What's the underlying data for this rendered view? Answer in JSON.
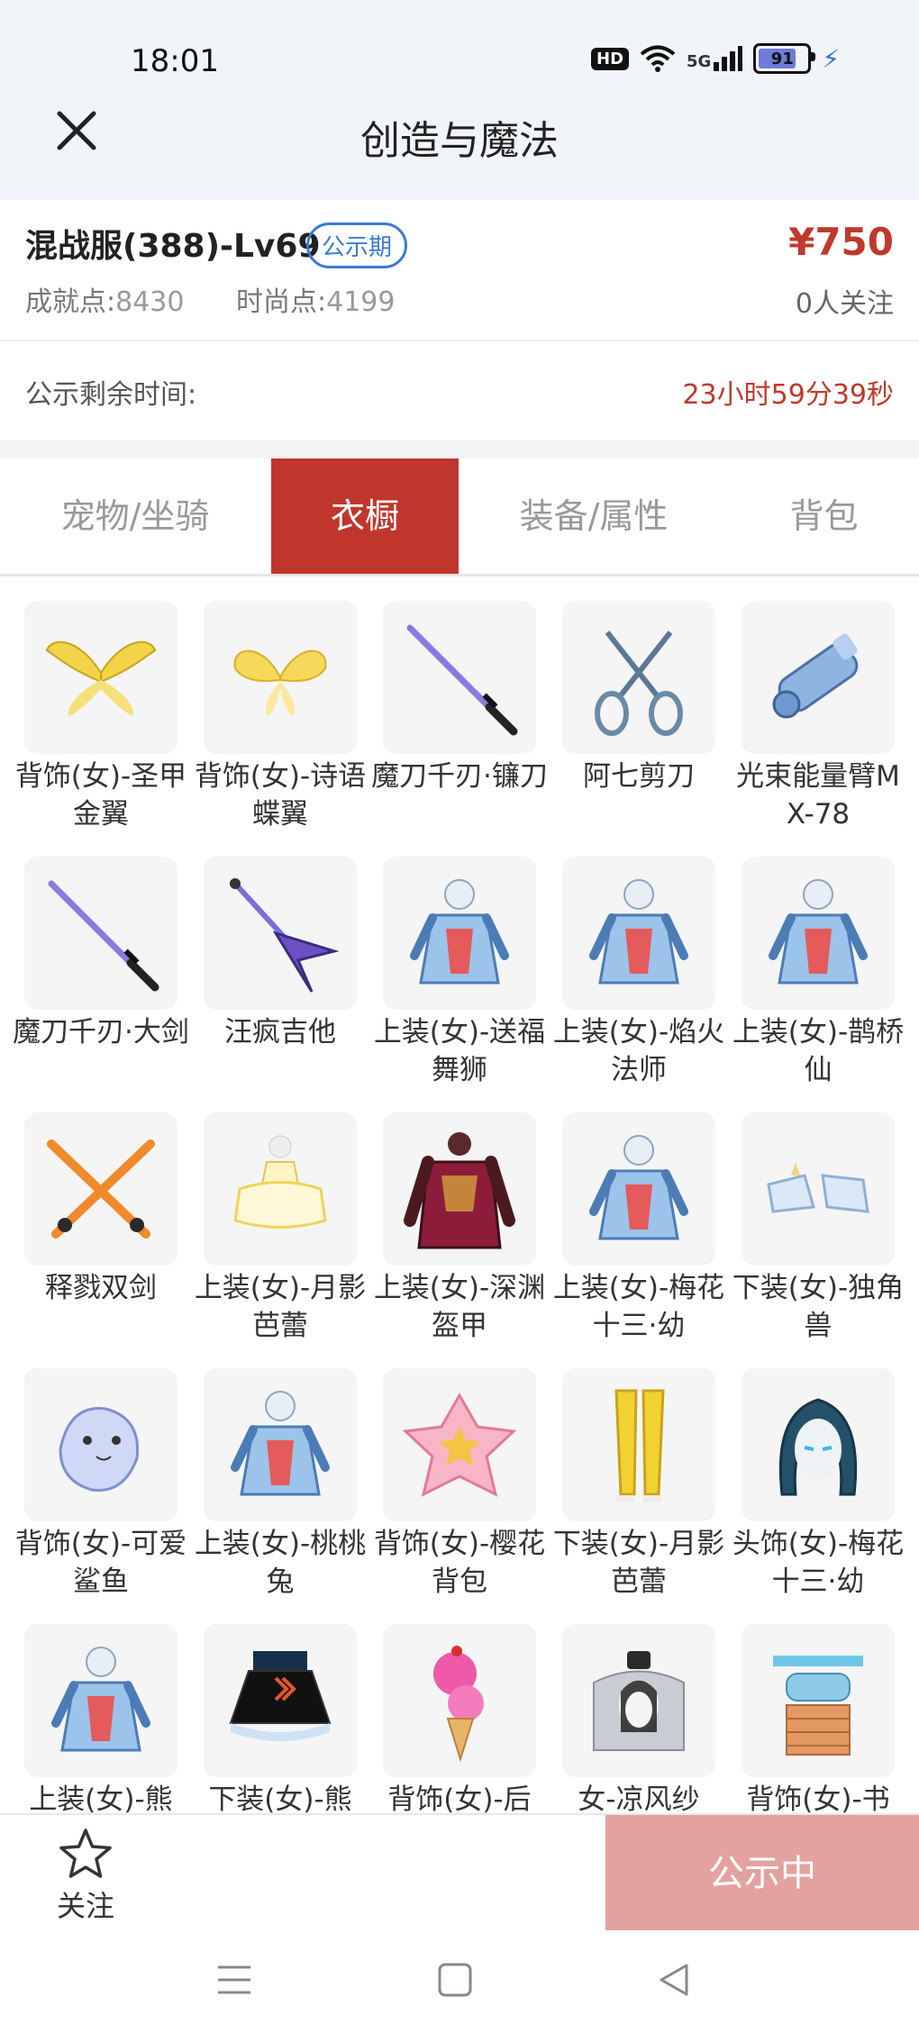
{
  "status_bar": {
    "time": "18:01",
    "hd": "HD",
    "network": "5G",
    "battery": "91"
  },
  "header": {
    "title": "创造与魔法"
  },
  "account": {
    "server": "混战服(388)-Lv69",
    "badge": "公示期",
    "achievement_label": "成就点:",
    "achievement_value": "8430",
    "fashion_label": "时尚点:",
    "fashion_value": "4199",
    "price": "¥750",
    "followers": "0人关注"
  },
  "remaining": {
    "label": "公示剩余时间:",
    "value": "23小时59分39秒"
  },
  "tabs": [
    {
      "label": "宠物/坐骑",
      "active": false
    },
    {
      "label": "衣橱",
      "active": true
    },
    {
      "label": "装备/属性",
      "active": false
    },
    {
      "label": "背包",
      "active": false
    }
  ],
  "items": [
    {
      "label": "背饰(女)-圣甲金翼",
      "icon": "wings-icon"
    },
    {
      "label": "背饰(女)-诗语蝶翼",
      "icon": "butterfly-wings-icon"
    },
    {
      "label": "魔刀千刃·镰刀",
      "icon": "blade-icon"
    },
    {
      "label": "阿七剪刀",
      "icon": "scissors-icon"
    },
    {
      "label": "光束能量臂MX-78",
      "icon": "arm-cannon-icon"
    },
    {
      "label": "魔刀千刃·大剑",
      "icon": "blade-icon"
    },
    {
      "label": "汪疯吉他",
      "icon": "guitar-icon"
    },
    {
      "label": "上装(女)-送福舞狮",
      "icon": "outfit-icon"
    },
    {
      "label": "上装(女)-焰火法师",
      "icon": "outfit-icon"
    },
    {
      "label": "上装(女)-鹊桥仙",
      "icon": "outfit-icon"
    },
    {
      "label": "释戮双剑",
      "icon": "twin-swords-icon"
    },
    {
      "label": "上装(女)-月影芭蕾",
      "icon": "dress-icon"
    },
    {
      "label": "上装(女)-深渊盔甲",
      "icon": "armor-icon"
    },
    {
      "label": "上装(女)-梅花十三·幼",
      "icon": "outfit-icon"
    },
    {
      "label": "下装(女)-独角兽",
      "icon": "shoes-icon"
    },
    {
      "label": "背饰(女)-可爱鲨鱼",
      "icon": "shark-icon"
    },
    {
      "label": "上装(女)-桃桃兔",
      "icon": "outfit-icon"
    },
    {
      "label": "背饰(女)-樱花背包",
      "icon": "backpack-icon"
    },
    {
      "label": "下装(女)-月影芭蕾",
      "icon": "pants-icon"
    },
    {
      "label": "头饰(女)-梅花十三·幼",
      "icon": "hair-icon"
    },
    {
      "label": "上装(女)-熊",
      "icon": "outfit-icon"
    },
    {
      "label": "下装(女)-熊",
      "icon": "skirt-icon"
    },
    {
      "label": "背饰(女)-后",
      "icon": "icecream-icon"
    },
    {
      "label": "女-凉风纱",
      "icon": "hat-icon"
    },
    {
      "label": "背饰(女)-书",
      "icon": "stall-icon"
    }
  ],
  "bottom": {
    "follow_label": "关注",
    "status_label": "公示中"
  },
  "colors": {
    "accent": "#c0362c",
    "price": "#c0392b",
    "badge": "#3b7bd1",
    "status_button": "#e3a29f"
  }
}
